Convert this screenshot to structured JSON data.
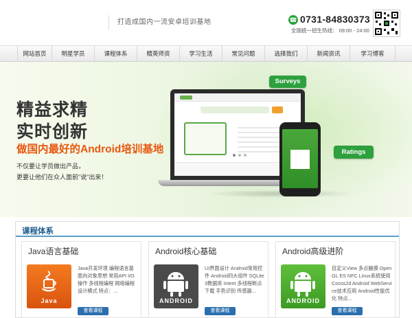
{
  "header": {
    "slogan": "打造成国内一流安卓培训基地",
    "phone": "0731-84830373",
    "hotline": "全国统一招生热线：  09:00 - 24:00"
  },
  "nav": {
    "items": [
      "网站首页",
      "明星学员",
      "课程体系",
      "精英师资",
      "学习生活",
      "常见问题",
      "选择我们",
      "新闻资讯",
      "学习博客"
    ]
  },
  "banner": {
    "headline1": "精益求精",
    "headline2": "实时创新",
    "headline3": "做国内最好的Android培训基地",
    "sub1": "不仅要让学员做出产品，",
    "sub2": "更要让他们在众人面前\"说\"出来！",
    "tag_surveys": "Surveys",
    "tag_ratings": "Ratings"
  },
  "courses": {
    "title": "课程体系",
    "cards": [
      {
        "title": "Java语言基础",
        "image_label": "Java",
        "desc": "Java开发环境 编程语言基 面向对象思想 常用API I/O 操作 多线程编程 网络编程 设计模式 特点：...",
        "button": "查看课程"
      },
      {
        "title": "Android核心基础",
        "image_label": "ANDROID",
        "desc": "UI界面设计 Android常用控件 Android四大组件 SQLite3数据库 Intent 多线程断点下载 手势识别 传感器...",
        "button": "查看课程"
      },
      {
        "title": "Android高级进阶",
        "image_label": "ANDROID",
        "desc": "自定义View 多点触摸 Open GL ES NFC Linux系统使用 Cocos2d Android WebService技术应用 Android性能优化 特点...",
        "button": "查看课程"
      }
    ]
  },
  "colors": {
    "accent_green": "#2ea03e",
    "accent_orange": "#e8570f",
    "link_blue": "#2b6fae"
  }
}
